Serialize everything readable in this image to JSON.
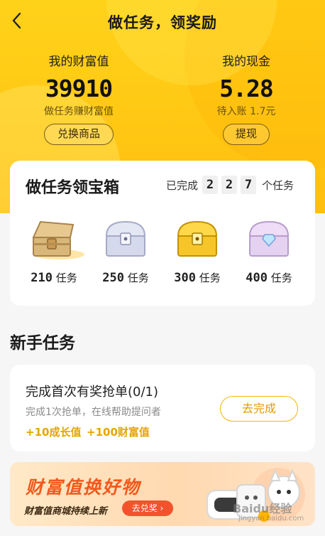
{
  "header": {
    "title": "做任务，领奖励"
  },
  "wealth": {
    "label": "我的财富值",
    "value": "39910",
    "sub": "做任务赚财富值",
    "button": "兑换商品"
  },
  "cash": {
    "label": "我的现金",
    "value": "5.28",
    "sub": "待入账 1.7元",
    "button": "提现"
  },
  "chest_card": {
    "title": "做任务领宝箱",
    "completed_prefix": "已完成",
    "completed_digits": [
      "2",
      "2",
      "7"
    ],
    "completed_suffix": "个任务",
    "chests": [
      {
        "count": "210",
        "unit": "任务",
        "icon": "open-wooden-chest-icon"
      },
      {
        "count": "250",
        "unit": "任务",
        "icon": "silver-chest-icon"
      },
      {
        "count": "300",
        "unit": "任务",
        "icon": "gold-chest-icon"
      },
      {
        "count": "400",
        "unit": "任务",
        "icon": "diamond-chest-icon"
      }
    ]
  },
  "newbie": {
    "section_title": "新手任务",
    "task": {
      "name": "完成首次有奖抢单(0/1)",
      "desc": "完成1次抢单，在线帮助提问者",
      "reward1": "+10成长值",
      "reward2": "+100财富值",
      "button": "去完成"
    }
  },
  "banner": {
    "title": "财富值换好物",
    "sub": "财富值商城持续上新",
    "button": "去兑奖 ›"
  },
  "watermark": {
    "text": "Baidu经验",
    "sub": "jingyan.baidu.com"
  },
  "colors": {
    "accent": "#ffc713",
    "reward": "#e6a400",
    "banner_title": "#f2581c"
  }
}
